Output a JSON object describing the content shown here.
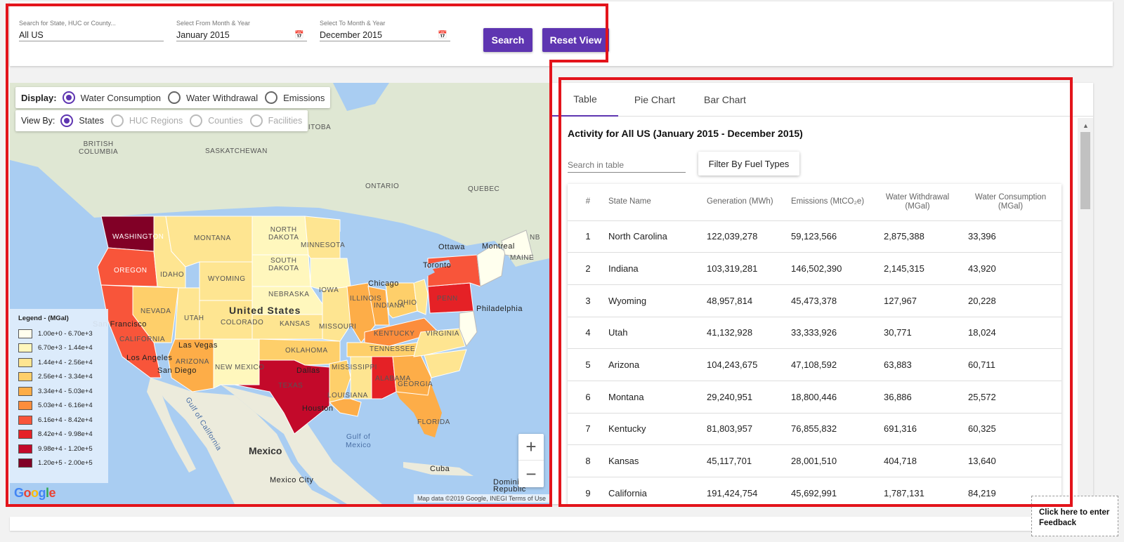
{
  "search": {
    "location_label": "Search for State, HUC or County...",
    "location_value": "All US",
    "from_label": "Select From Month & Year",
    "from_value": "January 2015",
    "to_label": "Select To Month & Year",
    "to_value": "December 2015",
    "search_button": "Search",
    "reset_button": "Reset View"
  },
  "map": {
    "display_label": "Display:",
    "display_options": [
      "Water Consumption",
      "Water Withdrawal",
      "Emissions"
    ],
    "display_selected": "Water Consumption",
    "viewby_label": "View By:",
    "viewby_options": [
      "States",
      "HUC Regions",
      "Counties",
      "Facilities"
    ],
    "viewby_selected": "States",
    "labels": {
      "british_columbia": "BRITISH\nCOLUMBIA",
      "saskatchewan": "SASKATCHEWAN",
      "manitoba": "ANITOBA",
      "ontario": "ONTARIO",
      "quebec": "QUEBEC",
      "nb": "NB",
      "washington": "WASHINGTON",
      "oregon": "OREGON",
      "idaho": "IDAHO",
      "montana": "MONTANA",
      "wyoming": "WYOMING",
      "north_dakota": "NORTH\nDAKOTA",
      "south_dakota": "SOUTH\nDAKOTA",
      "nebraska": "NEBRASKA",
      "minnesota": "MINNESOTA",
      "iowa": "IOWA",
      "nevada": "NEVADA",
      "utah": "UTAH",
      "colorado": "COLORADO",
      "kansas": "KANSAS",
      "missouri": "MISSOURI",
      "illinois": "ILLINOIS",
      "indiana": "INDIANA",
      "ohio": "OHIO",
      "penn": "PENN",
      "california": "CALIFORNIA",
      "arizona": "ARIZONA",
      "new_mexico": "NEW MEXICO",
      "oklahoma": "OKLAHOMA",
      "texas": "TEXAS",
      "tennessee": "TENNESSEE",
      "kentucky": "KENTUCKY",
      "virginia": "VIRGINIA",
      "mississippi": "MISSISSIPPI",
      "alabama": "ALABAMA",
      "georgia": "GEORGIA",
      "louisiana": "LOUISIANA",
      "florida": "FLORIDA",
      "maine": "MAINE",
      "united_states": "United States",
      "mexico": "Mexico",
      "ottawa": "Ottawa",
      "montreal": "Montreal",
      "toronto": "Toronto",
      "chicago": "Chicago",
      "philadelphia": "Philadelphia",
      "san_francisco": "San Francisco",
      "las_vegas": "Las Vegas",
      "los_angeles": "Los Angeles",
      "san_diego": "San Diego",
      "dallas": "Dallas",
      "houston": "Houston",
      "mexico_city": "Mexico City",
      "gulf_of_california": "Gulf of California",
      "gulf_of_mexico": "Gulf of\nMexico",
      "cuba": "Cuba",
      "dominican_republic": "Dominic\nRepublic"
    },
    "legend_title": "Legend - (MGal)",
    "legend": [
      {
        "range": "1.00e+0 - 6.70e+3",
        "color": "#ffffee"
      },
      {
        "range": "6.70e+3 - 1.44e+4",
        "color": "#fff7bd"
      },
      {
        "range": "1.44e+4 - 2.56e+4",
        "color": "#fee591"
      },
      {
        "range": "2.56e+4 - 3.34e+4",
        "color": "#fecf6a"
      },
      {
        "range": "3.34e+4 - 5.03e+4",
        "color": "#fdad48"
      },
      {
        "range": "5.03e+4 - 6.16e+4",
        "color": "#fc8d3c"
      },
      {
        "range": "6.16e+4 - 8.42e+4",
        "color": "#f8553a"
      },
      {
        "range": "8.42e+4 - 9.98e+4",
        "color": "#e52126"
      },
      {
        "range": "9.98e+4 - 1.20e+5",
        "color": "#c3092a"
      },
      {
        "range": "1.20e+5 - 2.00e+5",
        "color": "#810026"
      }
    ],
    "zoom_in": "+",
    "zoom_out": "−",
    "attribution": "Map data ©2019 Google, INEGI   Terms of Use"
  },
  "panel": {
    "tabs": [
      "Table",
      "Pie Chart",
      "Bar Chart"
    ],
    "active_tab": "Table",
    "title": "Activity for All US (January 2015 - December 2015)",
    "table_search_placeholder": "Search in table",
    "filter_button": "Filter By Fuel Types",
    "columns": [
      "#",
      "State Name",
      "Generation (MWh)",
      "Emissions (MtCO₂e)",
      "Water Withdrawal\n(MGal)",
      "Water Consumption\n(MGal)"
    ],
    "rows": [
      [
        "1",
        "North Carolina",
        "122,039,278",
        "59,123,566",
        "2,875,388",
        "33,396"
      ],
      [
        "2",
        "Indiana",
        "103,319,281",
        "146,502,390",
        "2,145,315",
        "43,920"
      ],
      [
        "3",
        "Wyoming",
        "48,957,814",
        "45,473,378",
        "127,967",
        "20,228"
      ],
      [
        "4",
        "Utah",
        "41,132,928",
        "33,333,926",
        "30,771",
        "18,024"
      ],
      [
        "5",
        "Arizona",
        "104,243,675",
        "47,108,592",
        "63,883",
        "60,711"
      ],
      [
        "6",
        "Montana",
        "29,240,951",
        "18,800,446",
        "36,886",
        "25,572"
      ],
      [
        "7",
        "Kentucky",
        "81,803,957",
        "76,855,832",
        "691,316",
        "60,325"
      ],
      [
        "8",
        "Kansas",
        "45,117,701",
        "28,001,510",
        "404,718",
        "13,640"
      ],
      [
        "9",
        "California",
        "191,424,754",
        "45,692,991",
        "1,787,131",
        "84,219"
      ]
    ]
  },
  "feedback": "Click here to enter\nFeedback"
}
